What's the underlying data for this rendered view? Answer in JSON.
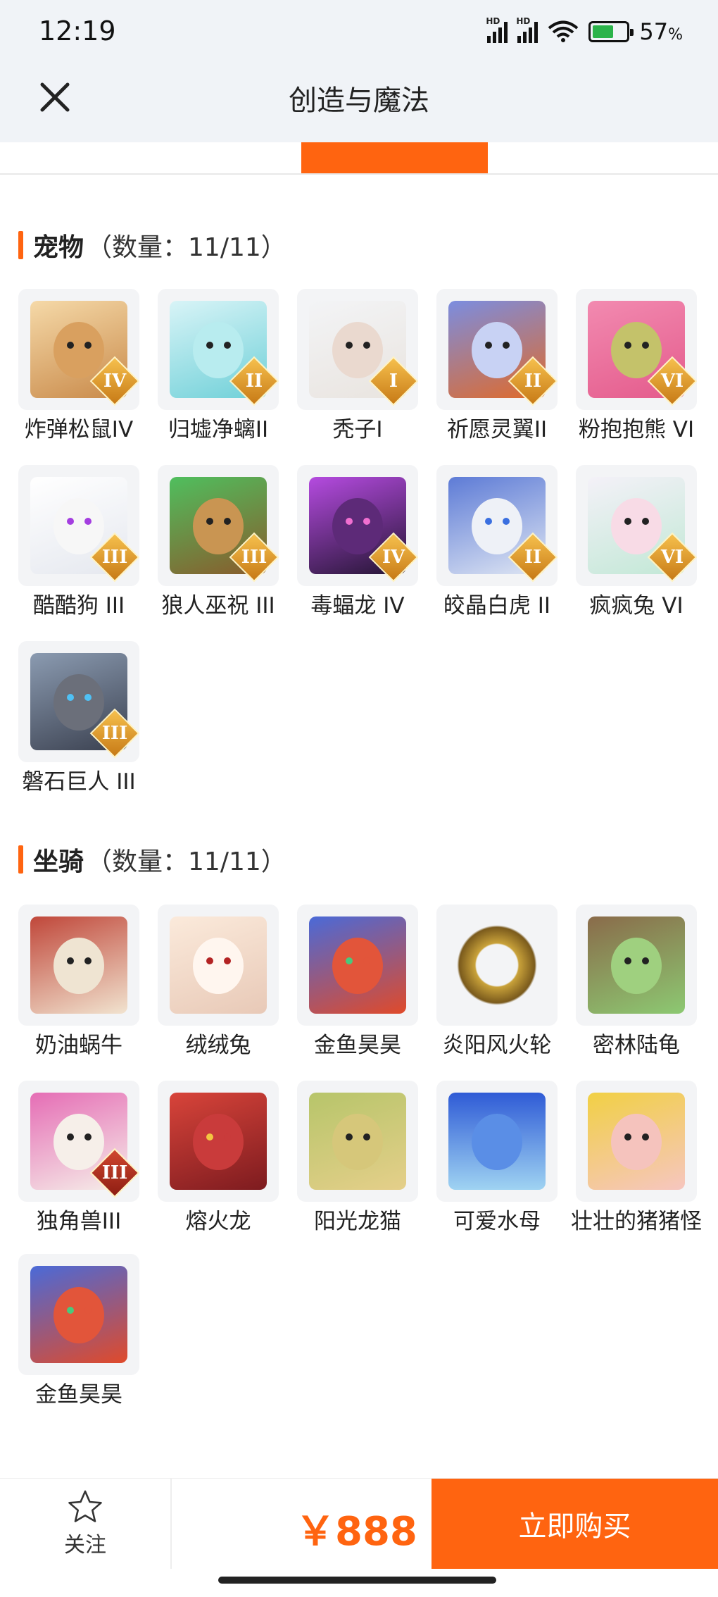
{
  "status_bar": {
    "time": "12:19",
    "battery": "57",
    "battery_unit": "%"
  },
  "header": {
    "title": "创造与魔法"
  },
  "pets": {
    "title": "宠物",
    "count_text": "（数量：11/11）",
    "items": [
      {
        "name": "炸弹松鼠IV",
        "tier": "IV"
      },
      {
        "name": "归墟净螭II",
        "tier": "II"
      },
      {
        "name": "秃子I",
        "tier": "I"
      },
      {
        "name": "祈愿灵翼II",
        "tier": "II"
      },
      {
        "name": "粉抱抱熊 VI",
        "tier": "VI"
      },
      {
        "name": "酷酷狗 III",
        "tier": "III"
      },
      {
        "name": "狼人巫祝 III",
        "tier": "III"
      },
      {
        "name": "毒蝠龙 IV",
        "tier": "IV"
      },
      {
        "name": "皎晶白虎 II",
        "tier": "II"
      },
      {
        "name": "疯疯兔 VI",
        "tier": "VI"
      },
      {
        "name": "磐石巨人 III",
        "tier": "III"
      }
    ]
  },
  "mounts": {
    "title": "坐骑",
    "count_text": "（数量：11/11）",
    "items": [
      {
        "name": "奶油蜗牛"
      },
      {
        "name": "绒绒兔"
      },
      {
        "name": "金鱼昊昊"
      },
      {
        "name": "炎阳风火轮"
      },
      {
        "name": "密林陆龟"
      },
      {
        "name": "独角兽III",
        "tier": "III"
      },
      {
        "name": "熔火龙"
      },
      {
        "name": "阳光龙猫"
      },
      {
        "name": "可爱水母"
      },
      {
        "name": "壮壮的猪猪怪"
      },
      {
        "name": "金鱼昊昊"
      }
    ]
  },
  "footer": {
    "follow_label": "关注",
    "price": "￥888",
    "buy_label": "立即购买"
  },
  "colors": {
    "accent": "#ff6410",
    "header_bg": "#f0f3f7",
    "thumb_bg": "#f3f4f6"
  }
}
